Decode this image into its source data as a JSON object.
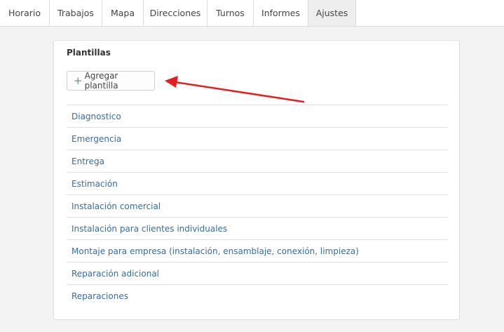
{
  "tabs": [
    {
      "label": "Horario",
      "active": false
    },
    {
      "label": "Trabajos",
      "active": false
    },
    {
      "label": "Mapa",
      "active": false
    },
    {
      "label": "Direcciones",
      "active": false
    },
    {
      "label": "Turnos",
      "active": false
    },
    {
      "label": "Informes",
      "active": false
    },
    {
      "label": "Ajustes",
      "active": true
    }
  ],
  "panel": {
    "title": "Plantillas",
    "add_button_label": "Agregar plantilla",
    "add_button_icon": "plus-icon",
    "templates": [
      "Diagnostico",
      "Emergencia",
      "Entrega",
      "Estimación",
      "Instalación comercial",
      "Instalación para clientes individuales",
      "Montaje para empresa (instalación, ensamblaje, conexión, limpieza)",
      "Reparación adicional",
      "Reparaciones"
    ]
  },
  "colors": {
    "link": "#2f6ea9",
    "plus": "#4cae4c",
    "annotation_arrow": "#e81c1c",
    "active_tab_bg": "#eeeeee"
  }
}
